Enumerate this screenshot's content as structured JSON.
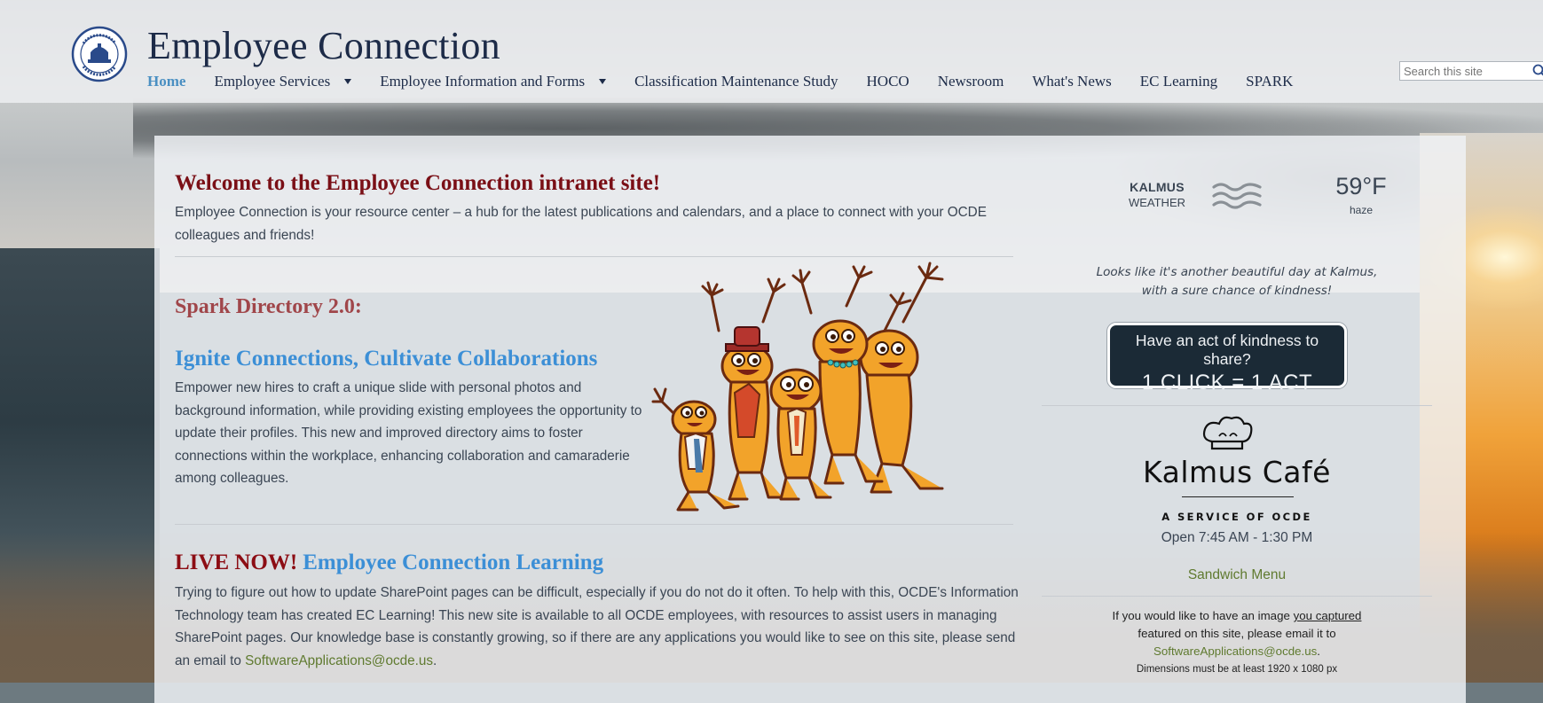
{
  "header": {
    "title": "Employee Connection",
    "search_placeholder": "Search this site",
    "nav": [
      {
        "label": "Home",
        "active": true,
        "has_dropdown": false
      },
      {
        "label": "Employee Services",
        "has_dropdown": true
      },
      {
        "label": "Employee Information and Forms",
        "has_dropdown": true
      },
      {
        "label": "Classification Maintenance Study",
        "has_dropdown": false
      },
      {
        "label": "HOCO",
        "has_dropdown": false
      },
      {
        "label": "Newsroom",
        "has_dropdown": false
      },
      {
        "label": "What's News",
        "has_dropdown": false
      },
      {
        "label": "EC Learning",
        "has_dropdown": false
      },
      {
        "label": "SPARK",
        "has_dropdown": false
      }
    ]
  },
  "main": {
    "welcome_heading": "Welcome to the Employee Connection intranet site!",
    "welcome_text": "Employee Connection is your resource center – a hub for the latest publications and calendars, and a place to connect with your OCDE colleagues and friends!",
    "spark_heading": "Spark Directory 2.0:",
    "ignite_heading": "Ignite Connections, Cultivate Collaborations",
    "spark_text": "Empower new hires to craft a unique slide with personal photos and background information, while providing existing employees the opportunity to update their profiles. This new and improved directory aims to foster connections within the workplace, enhancing collaboration and camaraderie among colleagues.",
    "live_now": "LIVE NOW!",
    "ecl_heading": "Employee Connection Learning",
    "ecl_text": "Trying to figure out how to update SharePoint pages can be difficult, especially if you do not do it often. To help with this, OCDE's Information Technology team has created EC Learning! This new site is available to all OCDE employees, with resources to assist users in managing SharePoint pages. Our knowledge base is constantly growing, so if there are any applications you would like to see on this site, please send an email to ",
    "ecl_email": "SoftwareApplications@ocde.us",
    "ecl_end": "."
  },
  "sidebar": {
    "weather": {
      "location": "KALMUS",
      "label": "WEATHER",
      "temperature": "59°F",
      "condition": "haze",
      "icon": "haze-icon"
    },
    "tagline_line1": "Looks like it's another beautiful day at Kalmus,",
    "tagline_line2": "with a sure chance of kindness!",
    "kindness_line1": "Have an act of kindness to share?",
    "kindness_line2": "1 CLICK = 1 ACT",
    "cafe": {
      "name": "Kalmus Café",
      "subtitle": "A SERVICE OF OCDE",
      "hours": "Open 7:45 AM - 1:30 PM",
      "menu_link": "Sandwich Menu"
    },
    "image_note_1": "If you would like to have an image ",
    "image_note_link": "you captured",
    "image_note_2": "featured on this site, please email it to",
    "image_note_email": "SoftwareApplications@ocde.us",
    "image_note_end": ".",
    "dimensions": "Dimensions must be at least 1920 x 1080 px"
  },
  "colors": {
    "title_navy": "#1d2b48",
    "welcome_maroon": "#7a0f16",
    "spark_rose": "#a0464a",
    "heading_blue": "#3c8fd6",
    "link_green": "#5f7a2f",
    "kindness_bg": "#1b2a36"
  }
}
